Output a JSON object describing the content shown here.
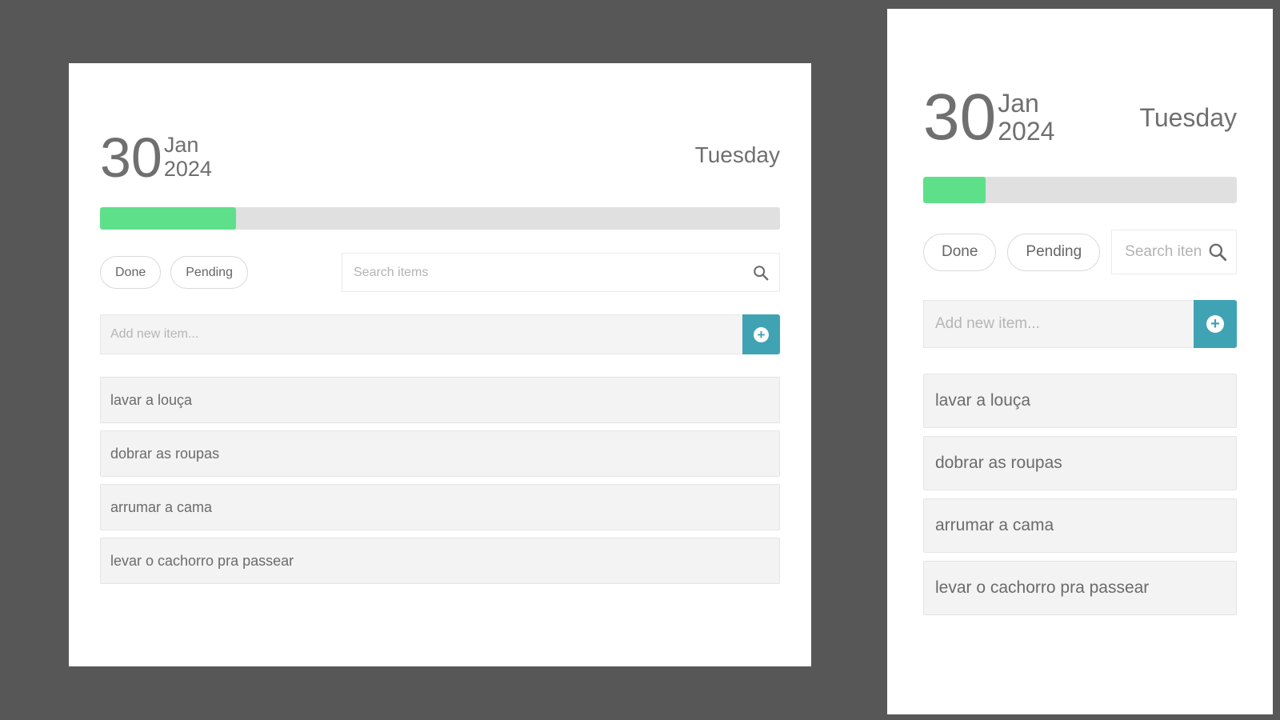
{
  "date": {
    "day": "30",
    "month": "Jan",
    "year": "2024",
    "weekday": "Tuesday"
  },
  "progress": {
    "fraction": 0.2,
    "color": "#5ee08b"
  },
  "filters": {
    "done_label": "Done",
    "pending_label": "Pending"
  },
  "search": {
    "placeholder_wide": "Search items",
    "placeholder_narrow": "Search iten",
    "icon": "search-icon"
  },
  "add_item": {
    "placeholder": "Add new item...",
    "icon": "plus-circle-icon",
    "button_color": "#3fa3b3"
  },
  "items": [
    {
      "text": "lavar a louça"
    },
    {
      "text": "dobrar as roupas"
    },
    {
      "text": "arrumar a cama"
    },
    {
      "text": "levar o cachorro pra passear"
    }
  ]
}
